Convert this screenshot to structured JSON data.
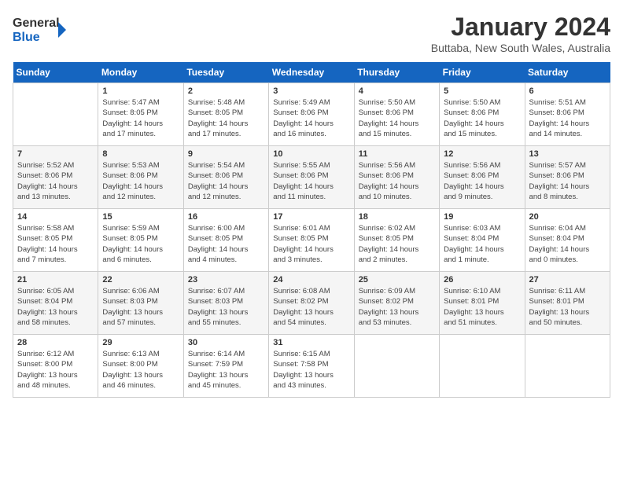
{
  "app": {
    "name": "GeneralBlue",
    "logo_icon": "▶"
  },
  "header": {
    "month": "January 2024",
    "location": "Buttaba, New South Wales, Australia"
  },
  "days_of_week": [
    "Sunday",
    "Monday",
    "Tuesday",
    "Wednesday",
    "Thursday",
    "Friday",
    "Saturday"
  ],
  "weeks": [
    [
      {
        "num": "",
        "info": ""
      },
      {
        "num": "1",
        "info": "Sunrise: 5:47 AM\nSunset: 8:05 PM\nDaylight: 14 hours\nand 17 minutes."
      },
      {
        "num": "2",
        "info": "Sunrise: 5:48 AM\nSunset: 8:05 PM\nDaylight: 14 hours\nand 17 minutes."
      },
      {
        "num": "3",
        "info": "Sunrise: 5:49 AM\nSunset: 8:06 PM\nDaylight: 14 hours\nand 16 minutes."
      },
      {
        "num": "4",
        "info": "Sunrise: 5:50 AM\nSunset: 8:06 PM\nDaylight: 14 hours\nand 15 minutes."
      },
      {
        "num": "5",
        "info": "Sunrise: 5:50 AM\nSunset: 8:06 PM\nDaylight: 14 hours\nand 15 minutes."
      },
      {
        "num": "6",
        "info": "Sunrise: 5:51 AM\nSunset: 8:06 PM\nDaylight: 14 hours\nand 14 minutes."
      }
    ],
    [
      {
        "num": "7",
        "info": "Sunrise: 5:52 AM\nSunset: 8:06 PM\nDaylight: 14 hours\nand 13 minutes."
      },
      {
        "num": "8",
        "info": "Sunrise: 5:53 AM\nSunset: 8:06 PM\nDaylight: 14 hours\nand 12 minutes."
      },
      {
        "num": "9",
        "info": "Sunrise: 5:54 AM\nSunset: 8:06 PM\nDaylight: 14 hours\nand 12 minutes."
      },
      {
        "num": "10",
        "info": "Sunrise: 5:55 AM\nSunset: 8:06 PM\nDaylight: 14 hours\nand 11 minutes."
      },
      {
        "num": "11",
        "info": "Sunrise: 5:56 AM\nSunset: 8:06 PM\nDaylight: 14 hours\nand 10 minutes."
      },
      {
        "num": "12",
        "info": "Sunrise: 5:56 AM\nSunset: 8:06 PM\nDaylight: 14 hours\nand 9 minutes."
      },
      {
        "num": "13",
        "info": "Sunrise: 5:57 AM\nSunset: 8:06 PM\nDaylight: 14 hours\nand 8 minutes."
      }
    ],
    [
      {
        "num": "14",
        "info": "Sunrise: 5:58 AM\nSunset: 8:05 PM\nDaylight: 14 hours\nand 7 minutes."
      },
      {
        "num": "15",
        "info": "Sunrise: 5:59 AM\nSunset: 8:05 PM\nDaylight: 14 hours\nand 6 minutes."
      },
      {
        "num": "16",
        "info": "Sunrise: 6:00 AM\nSunset: 8:05 PM\nDaylight: 14 hours\nand 4 minutes."
      },
      {
        "num": "17",
        "info": "Sunrise: 6:01 AM\nSunset: 8:05 PM\nDaylight: 14 hours\nand 3 minutes."
      },
      {
        "num": "18",
        "info": "Sunrise: 6:02 AM\nSunset: 8:05 PM\nDaylight: 14 hours\nand 2 minutes."
      },
      {
        "num": "19",
        "info": "Sunrise: 6:03 AM\nSunset: 8:04 PM\nDaylight: 14 hours\nand 1 minute."
      },
      {
        "num": "20",
        "info": "Sunrise: 6:04 AM\nSunset: 8:04 PM\nDaylight: 14 hours\nand 0 minutes."
      }
    ],
    [
      {
        "num": "21",
        "info": "Sunrise: 6:05 AM\nSunset: 8:04 PM\nDaylight: 13 hours\nand 58 minutes."
      },
      {
        "num": "22",
        "info": "Sunrise: 6:06 AM\nSunset: 8:03 PM\nDaylight: 13 hours\nand 57 minutes."
      },
      {
        "num": "23",
        "info": "Sunrise: 6:07 AM\nSunset: 8:03 PM\nDaylight: 13 hours\nand 55 minutes."
      },
      {
        "num": "24",
        "info": "Sunrise: 6:08 AM\nSunset: 8:02 PM\nDaylight: 13 hours\nand 54 minutes."
      },
      {
        "num": "25",
        "info": "Sunrise: 6:09 AM\nSunset: 8:02 PM\nDaylight: 13 hours\nand 53 minutes."
      },
      {
        "num": "26",
        "info": "Sunrise: 6:10 AM\nSunset: 8:01 PM\nDaylight: 13 hours\nand 51 minutes."
      },
      {
        "num": "27",
        "info": "Sunrise: 6:11 AM\nSunset: 8:01 PM\nDaylight: 13 hours\nand 50 minutes."
      }
    ],
    [
      {
        "num": "28",
        "info": "Sunrise: 6:12 AM\nSunset: 8:00 PM\nDaylight: 13 hours\nand 48 minutes."
      },
      {
        "num": "29",
        "info": "Sunrise: 6:13 AM\nSunset: 8:00 PM\nDaylight: 13 hours\nand 46 minutes."
      },
      {
        "num": "30",
        "info": "Sunrise: 6:14 AM\nSunset: 7:59 PM\nDaylight: 13 hours\nand 45 minutes."
      },
      {
        "num": "31",
        "info": "Sunrise: 6:15 AM\nSunset: 7:58 PM\nDaylight: 13 hours\nand 43 minutes."
      },
      {
        "num": "",
        "info": ""
      },
      {
        "num": "",
        "info": ""
      },
      {
        "num": "",
        "info": ""
      }
    ]
  ]
}
